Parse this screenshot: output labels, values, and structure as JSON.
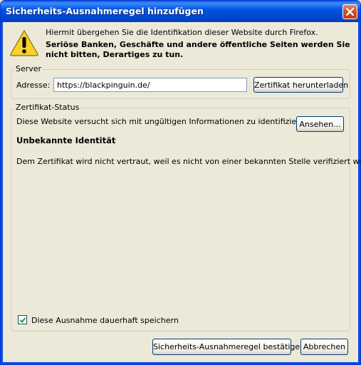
{
  "window": {
    "title": "Sicherheits-Ausnahmeregel hinzufügen"
  },
  "intro_text": "Hiermit übergehen Sie die Identifikation dieser Website durch Firefox.",
  "warning_text": "Seriöse Banken, Geschäfte und andere öffentliche Seiten werden Sie nicht bitten, Derartiges zu tun.",
  "server": {
    "legend": "Server",
    "address_label": "Adresse:",
    "address_value": "https://blackpinguin.de/",
    "download_button": "Zertifikat herunterladen"
  },
  "cert_status": {
    "legend": "Zertifikat-Status",
    "message": "Diese Website versucht sich mit ungültigen Informationen zu identifizieren.",
    "view_button": "Ansehen...",
    "heading": "Unbekannte Identität",
    "detail": "Dem Zertifikat wird nicht vertraut, weil es nicht von einer bekannten Stelle verifiziert wurde."
  },
  "permanent_checkbox": {
    "label": "Diese Ausnahme dauerhaft speichern",
    "checked": true
  },
  "buttons": {
    "confirm": "Sicherheits-Ausnahmeregel bestätigen",
    "cancel": "Abbrechen"
  },
  "icons": {
    "warning": "warning-icon",
    "close": "close-icon",
    "check": "check-icon"
  }
}
